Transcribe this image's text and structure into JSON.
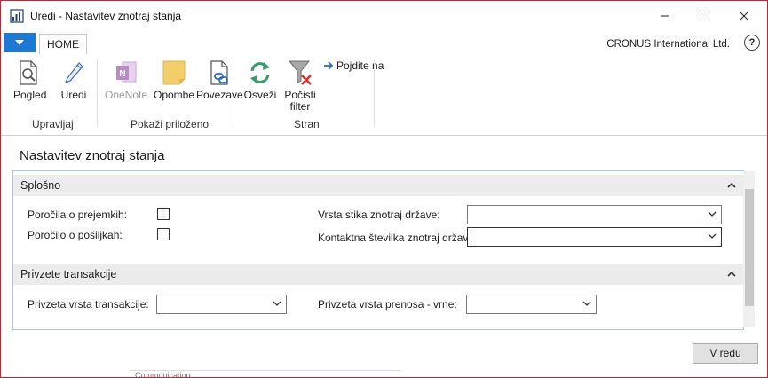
{
  "window": {
    "title": "Uredi - Nastavitev znotraj stanja",
    "buttons": [
      "minimize",
      "maximize",
      "close"
    ]
  },
  "ribbon": {
    "tab_home": "HOME",
    "company": "CRONUS International Ltd.",
    "help_label": "?",
    "buttons": {
      "pogled": "Pogled",
      "uredi": "Uredi",
      "onenote": "OneNote",
      "opombe": "Opombe",
      "povezave": "Povezave",
      "osvezi": "Osveži",
      "pocisti_filter_1": "Počisti",
      "pocisti_filter_2": "filter",
      "pojdite_na": "Pojdite na"
    },
    "groups": {
      "upravljaj": "Upravljaj",
      "pokazi_prilozeno": "Pokaži priloženo",
      "stran": "Stran"
    }
  },
  "page": {
    "title": "Nastavitev znotraj stanja"
  },
  "splosno": {
    "title": "Splošno",
    "caret": "^",
    "porocila_prejemkih": "Poročila o prejemkih:",
    "porocilo_posiljkah": "Poročilo o pošiljkah:",
    "vrsta_stika": "Vrsta stika znotraj države:",
    "kontaktna_stevilka": "Kontaktna številka znotraj države:",
    "porocila_prejemkih_checked": false,
    "porocilo_posiljkah_checked": false,
    "vrsta_stika_value": "",
    "kontaktna_stevilka_value": ""
  },
  "privzete": {
    "title": "Privzete transakcije",
    "caret": "^",
    "vrsta_transakcije": "Privzeta vrsta transakcije:",
    "vrsta_prenosa": "Privzeta vrsta prenosa - vrne:",
    "vrsta_transakcije_value": "",
    "vrsta_prenosa_value": ""
  },
  "footer": {
    "ok_label": "V redu",
    "background_text": "Communication"
  }
}
